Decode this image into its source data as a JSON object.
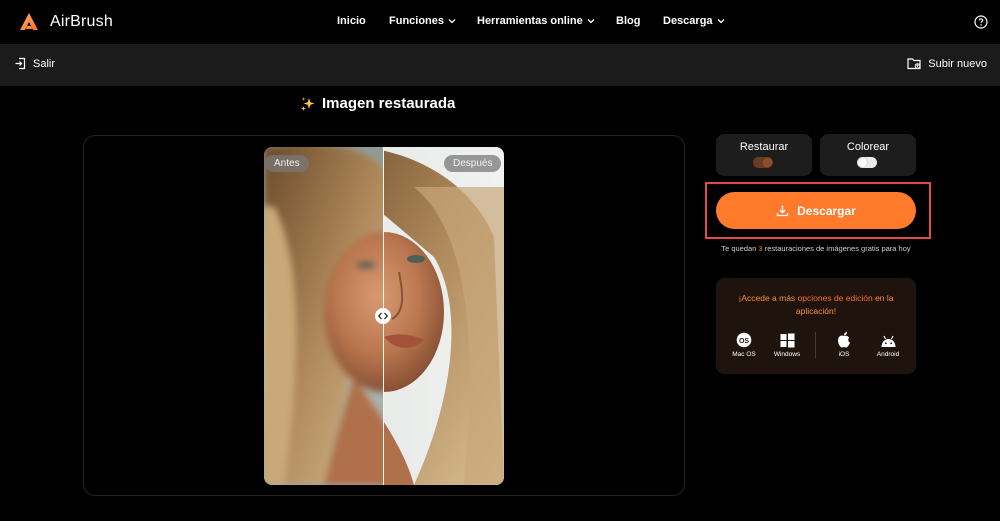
{
  "app": {
    "name": "AirBrush",
    "brand_color": "#ff7a2b"
  },
  "nav": {
    "links": [
      {
        "label": "Inicio",
        "has_dropdown": false
      },
      {
        "label": "Funciones",
        "has_dropdown": true
      },
      {
        "label": "Herramientas online",
        "has_dropdown": true
      },
      {
        "label": "Blog",
        "has_dropdown": false
      },
      {
        "label": "Descarga",
        "has_dropdown": true
      }
    ],
    "help_icon": "help-circle-icon"
  },
  "subbar": {
    "exit_label": "Salir",
    "upload_label": "Subir nuevo"
  },
  "editor": {
    "title": "Imagen restaurada",
    "title_icon": "sparkles-icon",
    "before_label": "Antes",
    "after_label": "Después",
    "slider_icon": "code-arrows-icon"
  },
  "options": {
    "restore": {
      "label": "Restaurar",
      "enabled": true
    },
    "colorize": {
      "label": "Colorear",
      "enabled": false
    }
  },
  "download": {
    "label": "Descargar",
    "icon": "download-icon",
    "remaining_prefix": "Te quedan",
    "remaining_count": "3",
    "remaining_suffix": "restauraciones de imágenes gratis para hoy"
  },
  "promo": {
    "text_prefix": "¡Accede a más",
    "text_highlight": "opciones de edición",
    "text_suffix": "en la aplicación!",
    "platforms": [
      {
        "label": "Mac OS",
        "icon": "macos-icon"
      },
      {
        "label": "Windows",
        "icon": "windows-icon"
      },
      {
        "label": "iOS",
        "icon": "apple-icon"
      },
      {
        "label": "Android",
        "icon": "android-icon"
      }
    ]
  }
}
